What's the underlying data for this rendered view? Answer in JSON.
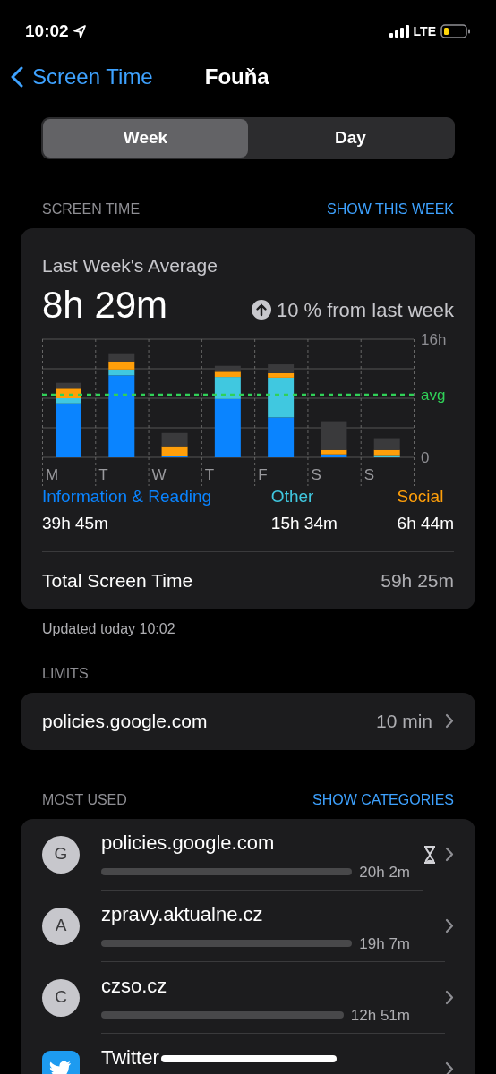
{
  "status_bar": {
    "time": "10:02",
    "network": "LTE"
  },
  "nav": {
    "back": "Screen Time",
    "title": "Fouňa"
  },
  "segments": [
    {
      "label": "Week",
      "selected": true
    },
    {
      "label": "Day",
      "selected": false
    }
  ],
  "screen_time": {
    "header": "SCREEN TIME",
    "action": "SHOW THIS WEEK",
    "title": "Last Week's Average",
    "average": "8h 29m",
    "change": "10 % from last week",
    "chart_data": {
      "type": "bar",
      "stacked": true,
      "categories": [
        "M",
        "T",
        "W",
        "T",
        "F",
        "S",
        "S"
      ],
      "ylim": [
        0,
        16
      ],
      "yticks": [
        {
          "value": 0,
          "label": "0"
        },
        {
          "value": 16,
          "label": "16h"
        }
      ],
      "series": [
        {
          "name": "Information & Reading",
          "color": "#0a84ff",
          "values": [
            7.3,
            11.1,
            0.2,
            7.9,
            5.4,
            0.4,
            0
          ]
        },
        {
          "name": "Other",
          "color": "#40c8e0",
          "values": [
            0.7,
            0.8,
            null,
            3.0,
            5.4,
            0,
            0.3
          ]
        },
        {
          "name": "Social",
          "color": "#ff9f0a",
          "values": [
            1.3,
            1.1,
            1.3,
            0.7,
            0.6,
            0.6,
            0.7
          ]
        },
        {
          "color": "#3a3a3c",
          "values": [
            0.8,
            1.1,
            1.8,
            0.8,
            1.2,
            3.9,
            1.6
          ]
        }
      ],
      "ref_lines": [
        {
          "axis": "y",
          "value": 8.48,
          "label": "avg",
          "color": "#30d158"
        }
      ]
    },
    "legend_values": [
      "39h 45m",
      "15h 34m",
      "6h 44m"
    ],
    "total_label": "Total Screen Time",
    "total_value": "59h 25m",
    "updated": "Updated today 10:02"
  },
  "limits": {
    "header": "LIMITS",
    "items": [
      {
        "name": "policies.google.com",
        "value": "10 min"
      }
    ]
  },
  "most_used": {
    "header": "MOST USED",
    "action": "SHOW CATEGORIES",
    "items": [
      {
        "kind": "letter",
        "icon_text": "G",
        "name": "policies.google.com",
        "time": "20h 2m",
        "limited": true
      },
      {
        "kind": "letter",
        "icon_text": "A",
        "name": "zpravy.aktualne.cz",
        "time": "19h 7m",
        "limited": false
      },
      {
        "kind": "letter",
        "icon_text": "C",
        "name": "czso.cz",
        "time": "12h 51m",
        "limited": false
      },
      {
        "kind": "twitter",
        "name": "Twitter",
        "limited": false
      }
    ]
  }
}
